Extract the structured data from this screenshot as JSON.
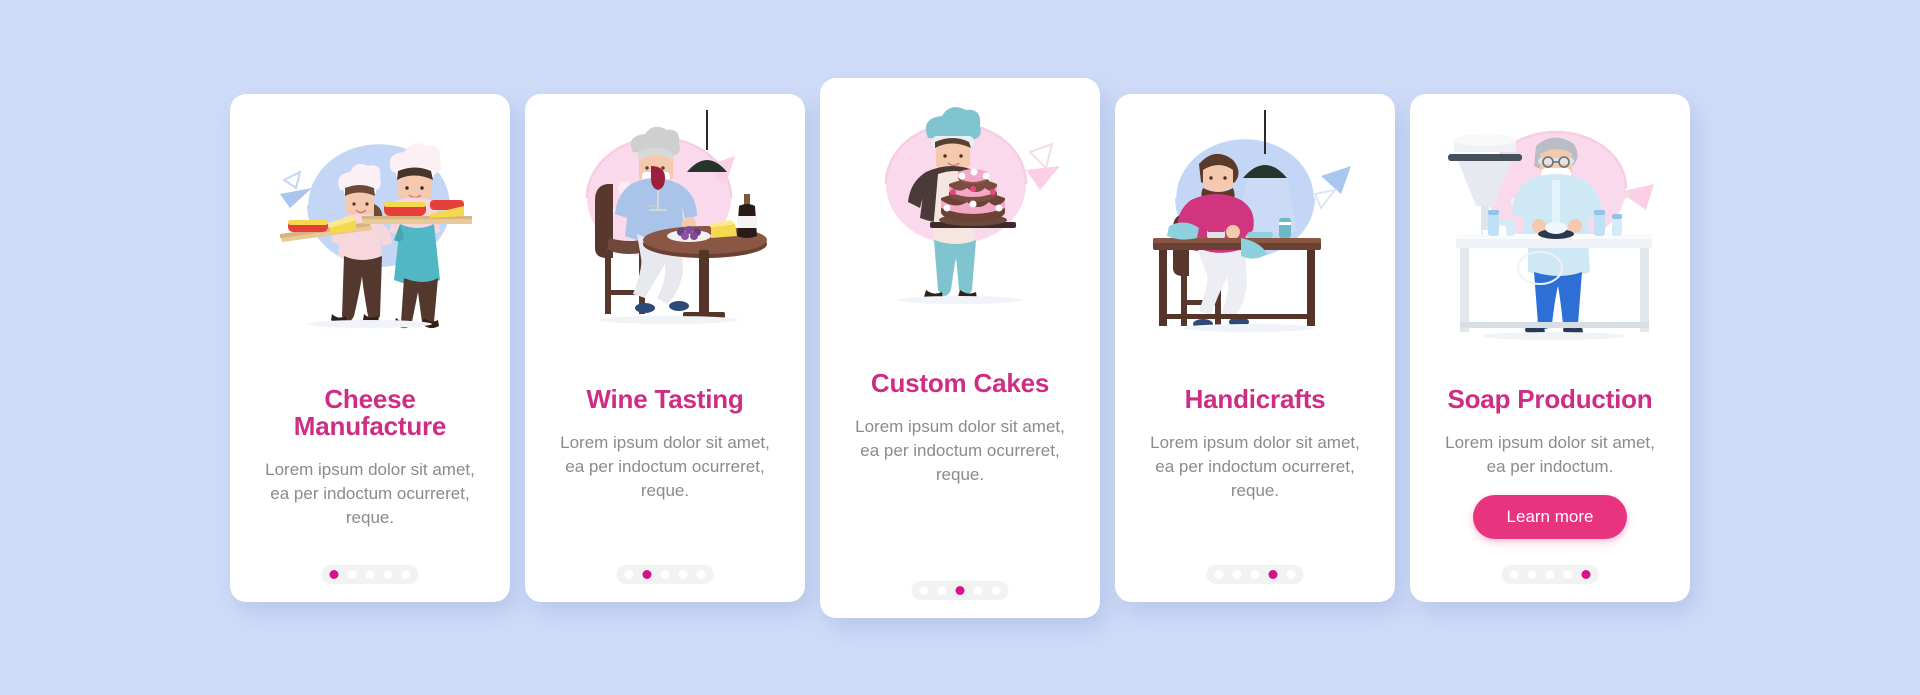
{
  "background_color": "#cfdcf8",
  "accent_color": "#cf2d84",
  "button_color": "#e8337f",
  "body_text_color": "#8b8b8b",
  "card_color": "#ffffff",
  "cards": [
    {
      "title": "Cheese\nManufacture",
      "title_line1": "Cheese",
      "title_line2": "Manufacture",
      "description": "Lorem ipsum dolor sit amet, ea per indoctum ocurreret, reque.",
      "illustration": "cheese-makers-illustration",
      "pager": {
        "total": 5,
        "active": 1
      },
      "featured": false,
      "cta": null
    },
    {
      "title": "Wine Tasting",
      "title_line1": "Wine Tasting",
      "title_line2": "",
      "description": "Lorem ipsum dolor sit amet, ea per indoctum ocurreret, reque.",
      "illustration": "wine-taster-illustration",
      "pager": {
        "total": 5,
        "active": 2
      },
      "featured": false,
      "cta": null
    },
    {
      "title": "Custom Cakes",
      "title_line1": "Custom Cakes",
      "title_line2": "",
      "description": "Lorem ipsum dolor sit amet, ea per indoctum ocurreret, reque.",
      "illustration": "cake-baker-illustration",
      "pager": {
        "total": 5,
        "active": 3
      },
      "featured": true,
      "cta": null
    },
    {
      "title": "Handicrafts",
      "title_line1": "Handicrafts",
      "title_line2": "",
      "description": "Lorem ipsum dolor sit amet, ea per indoctum ocurreret, reque.",
      "illustration": "craftsman-sewing-illustration",
      "pager": {
        "total": 5,
        "active": 4
      },
      "featured": false,
      "cta": null
    },
    {
      "title": "Soap Production",
      "title_line1": "Soap Production",
      "title_line2": "",
      "description": "Lorem ipsum dolor sit amet, ea per indoctum.",
      "illustration": "soap-factory-worker-illustration",
      "pager": {
        "total": 5,
        "active": 5
      },
      "featured": false,
      "cta": "Learn more"
    }
  ]
}
